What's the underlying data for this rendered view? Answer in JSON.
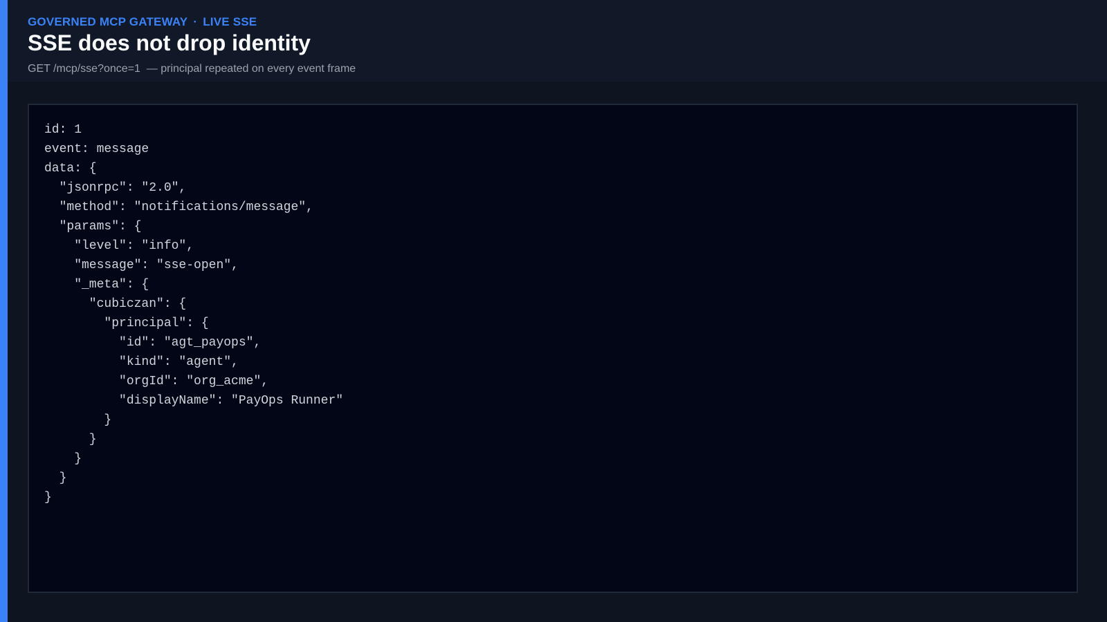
{
  "header": {
    "eyebrow_left": "GOVERNED MCP GATEWAY",
    "eyebrow_sep": "·",
    "eyebrow_right": "LIVE SSE",
    "title": "SSE does not drop identity",
    "subtitle": "GET /mcp/sse?once=1  — principal repeated on every event frame"
  },
  "sse_event": {
    "lines": [
      "id: 1",
      "event: message",
      "data: {",
      "  \"jsonrpc\": \"2.0\",",
      "  \"method\": \"notifications/message\",",
      "  \"params\": {",
      "    \"level\": \"info\",",
      "    \"message\": \"sse-open\",",
      "    \"_meta\": {",
      "      \"cubiczan\": {",
      "        \"principal\": {",
      "          \"id\": \"agt_payops\",",
      "          \"kind\": \"agent\",",
      "          \"orgId\": \"org_acme\",",
      "          \"displayName\": \"PayOps Runner\"",
      "        }",
      "      }",
      "    }",
      "  }",
      "}"
    ]
  },
  "colors": {
    "accent": "#3b82f6",
    "background": "#0e1420",
    "header_background": "#111827",
    "code_background": "#020617",
    "code_border": "#1f2937",
    "title": "#f9fafb",
    "subtitle": "#9ca3af",
    "code_text": "#d1d5db"
  }
}
